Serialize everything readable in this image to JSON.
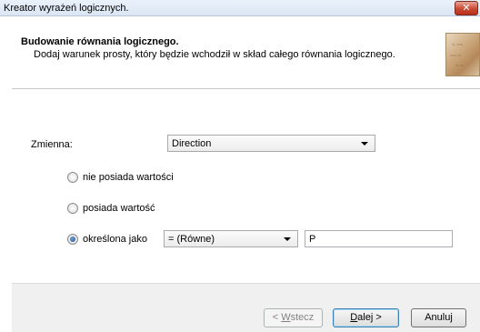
{
  "window": {
    "title": "Kreator wyrażeń logicznych."
  },
  "header": {
    "heading": "Budowanie równania logicznego.",
    "subheading": "Dodaj warunek prosty, który będzie wchodził w skład całego równania logicznego."
  },
  "form": {
    "variable_label": "Zmienna:",
    "variable_value": "Direction",
    "radios": [
      {
        "label": "nie posiada wartości",
        "checked": false
      },
      {
        "label": "posiada wartość",
        "checked": false
      },
      {
        "label": "określona jako",
        "checked": true
      }
    ],
    "operator_value": "= (Równe)",
    "compare_value": "P"
  },
  "buttons": {
    "back_prefix": "< ",
    "back_access": "W",
    "back_rest": "stecz",
    "next_access": "D",
    "next_rest": "alej >",
    "cancel": "Anuluj"
  },
  "icons": {
    "close": "close-icon",
    "header_image": "header-image"
  }
}
